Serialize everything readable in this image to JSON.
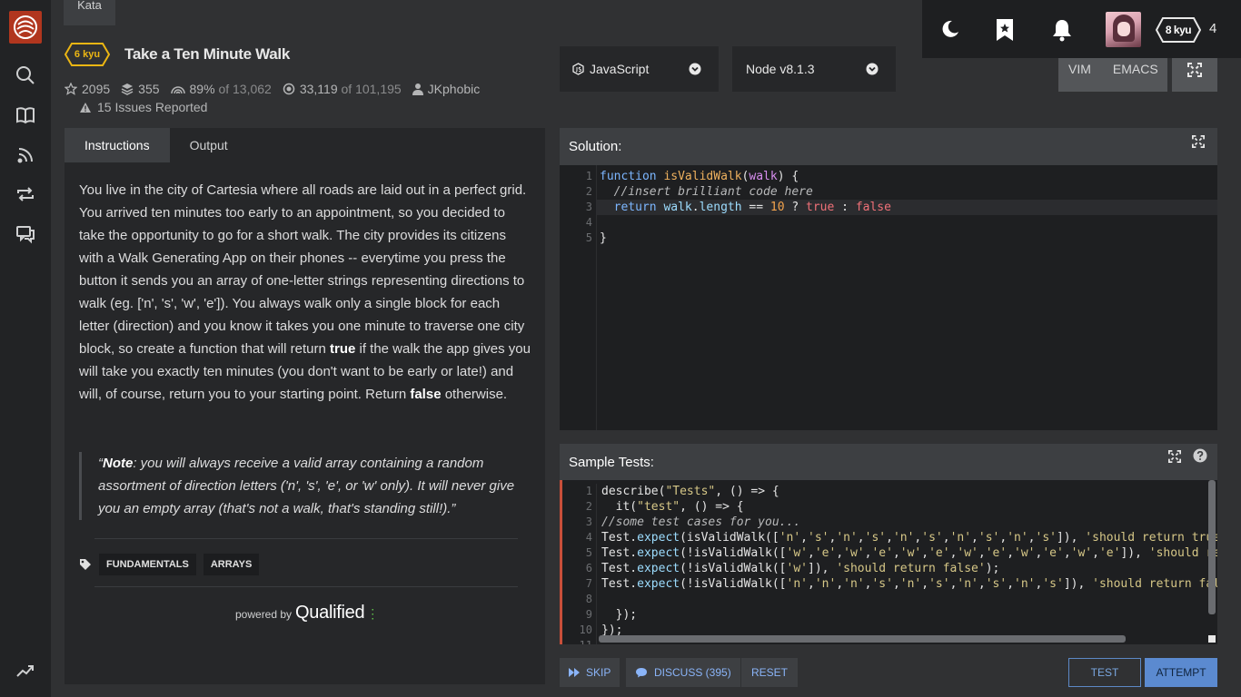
{
  "kata_tab": "Kata",
  "kata": {
    "rank": "6 kyu",
    "title": "Take a Ten Minute Walk",
    "stars": "2095",
    "collections": "355",
    "satisfaction": "89%",
    "satisfaction_of": "of 13,062",
    "completed": "33,119",
    "completed_of": "of 101,195",
    "author": "JKphobic",
    "issues": "15 Issues Reported"
  },
  "user": {
    "rank": "8 kyu",
    "honor": "4"
  },
  "tabs": {
    "instructions": "Instructions",
    "output": "Output"
  },
  "description": {
    "p1a": "You live in the city of Cartesia where all roads are laid out in a perfect grid. You arrived ten minutes too early to an appointment, so you decided to take the opportunity to go for a short walk. The city provides its citizens with a Walk Generating App on their phones -- everytime you press the button it sends you an array of one-letter strings representing directions to walk (eg. ['n', 's', 'w', 'e']). You always walk only a single block for each letter (direction) and you know it takes you one minute to traverse one city block, so create a function that will return ",
    "p1b": "true",
    "p1c": " if the walk the app gives you will take you exactly ten minutes (you don't want to be early or late!) and will, of course, return you to your starting point. Return ",
    "p1d": "false",
    "p1e": " otherwise.",
    "note_open": "“",
    "note_label": "Note",
    "note_text": ": you will always receive a valid array containing a random assortment of direction letters ('n', 's', 'e', or 'w' only). It will never give you an empty array (that's not a walk, that's standing still!).”"
  },
  "tags": [
    "FUNDAMENTALS",
    "ARRAYS"
  ],
  "powered": {
    "prefix": "powered by",
    "brand": "Qualified"
  },
  "language": {
    "label": "JavaScript",
    "version": "Node v8.1.3"
  },
  "editor_modes": {
    "vim": "VIM",
    "emacs": "EMACS"
  },
  "solution": {
    "header": "Solution:",
    "line_numbers": [
      "1",
      "2",
      "3",
      "4",
      "5"
    ],
    "lines": [
      [
        {
          "t": "function ",
          "c": "k"
        },
        {
          "t": "isValidWalk",
          "c": "f"
        },
        {
          "t": "(",
          "c": ""
        },
        {
          "t": "walk",
          "c": "p"
        },
        {
          "t": ") {",
          "c": ""
        }
      ],
      [
        {
          "t": "  //insert brilliant code here",
          "c": "c"
        }
      ],
      [
        {
          "t": "  ",
          "c": ""
        },
        {
          "t": "return ",
          "c": "k"
        },
        {
          "t": "walk",
          "c": "m"
        },
        {
          "t": ".",
          "c": ""
        },
        {
          "t": "length",
          "c": "m"
        },
        {
          "t": " == ",
          "c": ""
        },
        {
          "t": "10",
          "c": "n"
        },
        {
          "t": " ? ",
          "c": ""
        },
        {
          "t": "true",
          "c": "r"
        },
        {
          "t": " : ",
          "c": ""
        },
        {
          "t": "false",
          "c": "r"
        }
      ],
      [
        {
          "t": "",
          "c": ""
        }
      ],
      [
        {
          "t": "}",
          "c": ""
        }
      ]
    ]
  },
  "sample_tests": {
    "header": "Sample Tests:",
    "line_numbers": [
      "1",
      "2",
      "3",
      "4",
      "5",
      "6",
      "7",
      "8",
      "9",
      "10",
      "11"
    ],
    "lines": [
      [
        {
          "t": "describe(",
          "c": ""
        },
        {
          "t": "\"Tests\"",
          "c": "s"
        },
        {
          "t": ", () => {",
          "c": ""
        }
      ],
      [
        {
          "t": "  it(",
          "c": ""
        },
        {
          "t": "\"test\"",
          "c": "s"
        },
        {
          "t": ", () => {",
          "c": ""
        }
      ],
      [
        {
          "t": "//some test cases for you...",
          "c": "c"
        }
      ],
      [
        {
          "t": "Test.",
          "c": ""
        },
        {
          "t": "expect",
          "c": "m"
        },
        {
          "t": "(isValidWalk([",
          "c": ""
        },
        {
          "t": "'n'",
          "c": "s"
        },
        {
          "t": ",",
          "c": ""
        },
        {
          "t": "'s'",
          "c": "s"
        },
        {
          "t": ",",
          "c": ""
        },
        {
          "t": "'n'",
          "c": "s"
        },
        {
          "t": ",",
          "c": ""
        },
        {
          "t": "'s'",
          "c": "s"
        },
        {
          "t": ",",
          "c": ""
        },
        {
          "t": "'n'",
          "c": "s"
        },
        {
          "t": ",",
          "c": ""
        },
        {
          "t": "'s'",
          "c": "s"
        },
        {
          "t": ",",
          "c": ""
        },
        {
          "t": "'n'",
          "c": "s"
        },
        {
          "t": ",",
          "c": ""
        },
        {
          "t": "'s'",
          "c": "s"
        },
        {
          "t": ",",
          "c": ""
        },
        {
          "t": "'n'",
          "c": "s"
        },
        {
          "t": ",",
          "c": ""
        },
        {
          "t": "'s'",
          "c": "s"
        },
        {
          "t": "]), ",
          "c": ""
        },
        {
          "t": "'should return true'",
          "c": "s"
        }
      ],
      [
        {
          "t": "Test.",
          "c": ""
        },
        {
          "t": "expect",
          "c": "m"
        },
        {
          "t": "(!isValidWalk([",
          "c": ""
        },
        {
          "t": "'w'",
          "c": "s"
        },
        {
          "t": ",",
          "c": ""
        },
        {
          "t": "'e'",
          "c": "s"
        },
        {
          "t": ",",
          "c": ""
        },
        {
          "t": "'w'",
          "c": "s"
        },
        {
          "t": ",",
          "c": ""
        },
        {
          "t": "'e'",
          "c": "s"
        },
        {
          "t": ",",
          "c": ""
        },
        {
          "t": "'w'",
          "c": "s"
        },
        {
          "t": ",",
          "c": ""
        },
        {
          "t": "'e'",
          "c": "s"
        },
        {
          "t": ",",
          "c": ""
        },
        {
          "t": "'w'",
          "c": "s"
        },
        {
          "t": ",",
          "c": ""
        },
        {
          "t": "'e'",
          "c": "s"
        },
        {
          "t": ",",
          "c": ""
        },
        {
          "t": "'w'",
          "c": "s"
        },
        {
          "t": ",",
          "c": ""
        },
        {
          "t": "'e'",
          "c": "s"
        },
        {
          "t": ",",
          "c": ""
        },
        {
          "t": "'w'",
          "c": "s"
        },
        {
          "t": ",",
          "c": ""
        },
        {
          "t": "'e'",
          "c": "s"
        },
        {
          "t": "]), ",
          "c": ""
        },
        {
          "t": "'should return false'",
          "c": "s"
        }
      ],
      [
        {
          "t": "Test.",
          "c": ""
        },
        {
          "t": "expect",
          "c": "m"
        },
        {
          "t": "(!isValidWalk([",
          "c": ""
        },
        {
          "t": "'w'",
          "c": "s"
        },
        {
          "t": "]), ",
          "c": ""
        },
        {
          "t": "'should return false'",
          "c": "s"
        },
        {
          "t": ");",
          "c": ""
        }
      ],
      [
        {
          "t": "Test.",
          "c": ""
        },
        {
          "t": "expect",
          "c": "m"
        },
        {
          "t": "(!isValidWalk([",
          "c": ""
        },
        {
          "t": "'n'",
          "c": "s"
        },
        {
          "t": ",",
          "c": ""
        },
        {
          "t": "'n'",
          "c": "s"
        },
        {
          "t": ",",
          "c": ""
        },
        {
          "t": "'n'",
          "c": "s"
        },
        {
          "t": ",",
          "c": ""
        },
        {
          "t": "'s'",
          "c": "s"
        },
        {
          "t": ",",
          "c": ""
        },
        {
          "t": "'n'",
          "c": "s"
        },
        {
          "t": ",",
          "c": ""
        },
        {
          "t": "'s'",
          "c": "s"
        },
        {
          "t": ",",
          "c": ""
        },
        {
          "t": "'n'",
          "c": "s"
        },
        {
          "t": ",",
          "c": ""
        },
        {
          "t": "'s'",
          "c": "s"
        },
        {
          "t": ",",
          "c": ""
        },
        {
          "t": "'n'",
          "c": "s"
        },
        {
          "t": ",",
          "c": ""
        },
        {
          "t": "'s'",
          "c": "s"
        },
        {
          "t": "]), ",
          "c": ""
        },
        {
          "t": "'should return false'",
          "c": "s"
        }
      ],
      [
        {
          "t": "",
          "c": ""
        }
      ],
      [
        {
          "t": "  });",
          "c": ""
        }
      ],
      [
        {
          "t": "});",
          "c": ""
        }
      ],
      [
        {
          "t": "",
          "c": ""
        }
      ]
    ]
  },
  "buttons": {
    "skip": "SKIP",
    "discuss": "DISCUSS (395)",
    "reset": "RESET",
    "test": "TEST",
    "attempt": "ATTEMPT"
  },
  "colors": {
    "kyu_yellow": "#ecb613",
    "accent_blue": "#5b8ad0",
    "brand_red": "#b1361e"
  }
}
